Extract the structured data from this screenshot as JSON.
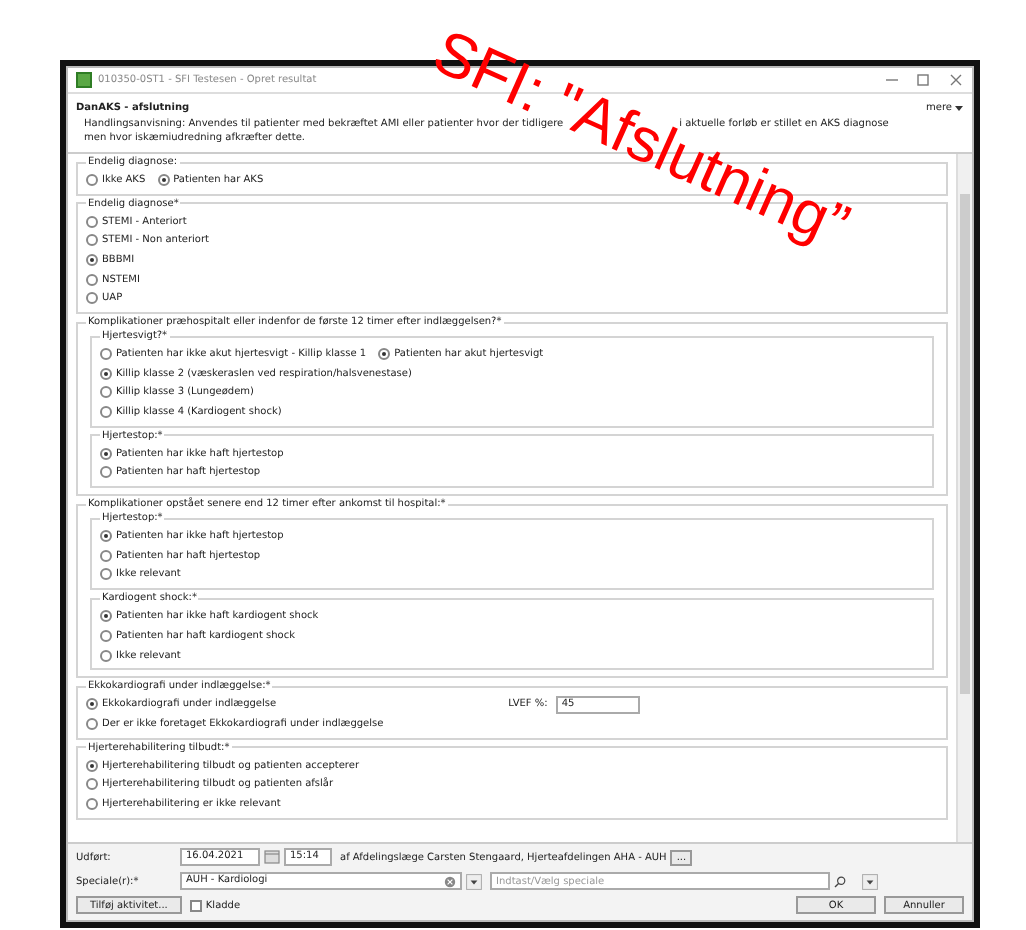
{
  "window": {
    "title": "010350-0ST1 - SFI Testesen - Opret resultat"
  },
  "header": {
    "title": "DanAKS - afslutning",
    "menu": "mere",
    "instruction_lines": [
      [
        "Handlingsanvisning: Anvendes til patienter med bekræftet AMI eller patienter hvor der tidligere",
        "i aktuelle forløb er stillet en AKS diagnose"
      ],
      [
        "men hvor iskæmiudredning afkræfter dette."
      ]
    ]
  },
  "sections": [
    {
      "legend": "Endelig diagnose:",
      "groups": [
        {
          "rows": [
            [
              {
                "kind": "radio",
                "label": "Ikke AKS",
                "selected": false
              },
              {
                "kind": "radio",
                "label": "Patienten har AKS",
                "selected": true
              }
            ]
          ]
        }
      ]
    },
    {
      "legend": "Endelig diagnose*",
      "groups": [
        {
          "rows": [
            [
              {
                "kind": "radio",
                "label": "STEMI - Anteriort",
                "selected": false
              }
            ],
            [
              {
                "kind": "radio",
                "label": "STEMI - Non anteriort",
                "selected": false
              }
            ],
            [
              {
                "kind": "radio",
                "label": "BBBMI",
                "selected": true
              }
            ],
            [
              {
                "kind": "radio",
                "label": "NSTEMI",
                "selected": false
              }
            ],
            [
              {
                "kind": "radio",
                "label": "UAP",
                "selected": false
              }
            ]
          ]
        }
      ]
    },
    {
      "legend": "Komplikationer præhospitalt eller indenfor de første 12 timer efter indlæggelsen?*",
      "groups": [
        {
          "legend": "Hjertesvigt?*",
          "rows": [
            [
              {
                "kind": "radio",
                "label": "Patienten har ikke akut hjertesvigt - Killip klasse 1",
                "selected": false
              },
              {
                "kind": "radio",
                "label": "Patienten har akut hjertesvigt",
                "selected": true
              }
            ],
            [
              {
                "kind": "radio",
                "label": "Killip klasse 2 (væskeraslen ved respiration/halsvenestase)",
                "selected": true
              }
            ],
            [
              {
                "kind": "radio",
                "label": "Killip klasse 3 (Lungeødem)",
                "selected": false
              }
            ],
            [
              {
                "kind": "radio",
                "label": "Killip klasse 4 (Kardiogent shock)",
                "selected": false
              }
            ]
          ]
        },
        {
          "legend": "Hjertestop:*",
          "rows": [
            [
              {
                "kind": "radio",
                "label": "Patienten har ikke haft hjertestop",
                "selected": true
              }
            ],
            [
              {
                "kind": "radio",
                "label": "Patienten har haft hjertestop",
                "selected": false
              }
            ]
          ]
        }
      ]
    },
    {
      "legend": "Komplikationer opstået senere end 12 timer efter ankomst til hospital:*",
      "groups": [
        {
          "legend": "Hjertestop:*",
          "rows": [
            [
              {
                "kind": "radio",
                "label": "Patienten har ikke haft hjertestop",
                "selected": true
              }
            ],
            [
              {
                "kind": "radio",
                "label": "Patienten har haft hjertestop",
                "selected": false
              }
            ],
            [
              {
                "kind": "radio",
                "label": "Ikke relevant",
                "selected": false
              }
            ]
          ]
        },
        {
          "legend": "Kardiogent shock:*",
          "rows": [
            [
              {
                "kind": "radio",
                "label": "Patienten har ikke haft kardiogent shock",
                "selected": true
              }
            ],
            [
              {
                "kind": "radio",
                "label": "Patienten har haft kardiogent shock",
                "selected": false
              }
            ],
            [
              {
                "kind": "radio",
                "label": "Ikke relevant",
                "selected": false
              }
            ]
          ]
        }
      ]
    },
    {
      "legend": "Ekkokardiografi under indlæggelse:*",
      "groups": [
        {
          "rows": [
            [
              {
                "kind": "radio",
                "label": "Ekkokardiografi under indlæggelse",
                "selected": true
              },
              {
                "kind": "field",
                "label": "LVEF %:",
                "value": "45"
              }
            ],
            [
              {
                "kind": "radio",
                "label": "Der er ikke foretaget Ekkokardiografi under indlæggelse",
                "selected": false
              }
            ]
          ]
        }
      ]
    },
    {
      "legend": "Hjerterehabilitering tilbudt:*",
      "groups": [
        {
          "rows": [
            [
              {
                "kind": "radio",
                "label": "Hjerterehabilitering tilbudt og patienten accepterer",
                "selected": true
              }
            ],
            [
              {
                "kind": "radio",
                "label": "Hjerterehabilitering tilbudt og patienten afslår",
                "selected": false
              }
            ],
            [
              {
                "kind": "radio",
                "label": "Hjerterehabilitering er ikke relevant",
                "selected": false
              }
            ]
          ]
        }
      ]
    }
  ],
  "footer": {
    "performed_label": "Udført:",
    "date": "16.04.2021",
    "time": "15:14",
    "performed_by": "af Afdelingslæge Carsten Stengaard, Hjerteafdelingen AHA - AUH",
    "more_button": "...",
    "specialty_label": "Speciale(r):*",
    "specialty": "AUH - Kardiologi",
    "specialty_placeholder": "Indtast/Vælg speciale",
    "add_button": "Tilføj aktivitet...",
    "draft": {
      "label": "Kladde",
      "checked": false
    },
    "ok_button": "OK",
    "cancel_button": "Annuller"
  },
  "annotation": "SFI: \"Afslutning”"
}
